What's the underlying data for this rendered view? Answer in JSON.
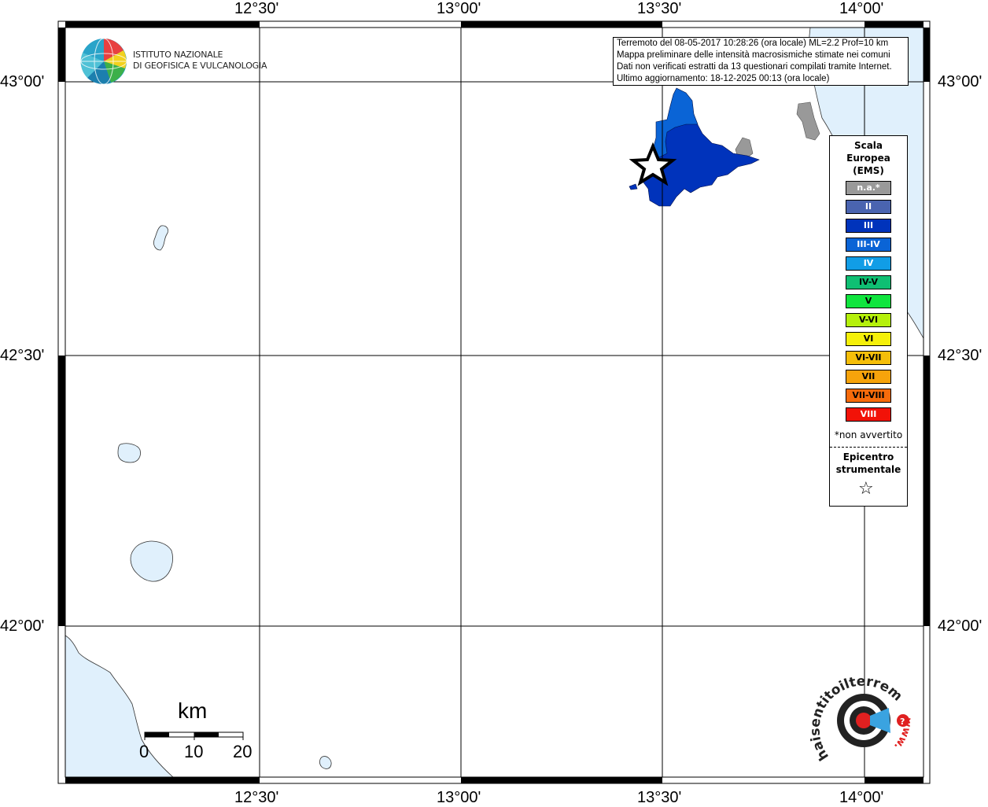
{
  "map": {
    "lon_labels": [
      "12°30'",
      "13°00'",
      "13°30'",
      "14°00'"
    ],
    "lat_labels": [
      "43°00'",
      "42°30'",
      "42°00'"
    ],
    "colors": {
      "sea": "#e0f0fc",
      "coast_stroke": "#333333",
      "grid": "#000000",
      "intensity_III": "#0033bb",
      "intensity_III_IV": "#0a64d6",
      "na_gray": "#999999"
    }
  },
  "logo": {
    "line1": "ISTITUTO NAZIONALE",
    "line2": "DI GEOFISICA E VULCANOLOGIA"
  },
  "info": {
    "line1": "Terremoto del 08-05-2017 10:28:26 (ora locale) ML=2.2 Prof=10 km",
    "line2": "Mappa preliminare delle intensità macrosismiche stimate nei comuni",
    "line3": "Dati non verificati estratti da 13 questionari compilati tramite Internet.",
    "line4": "Ultimo aggiornamento: 18-12-2025 00:13 (ora locale)"
  },
  "legend": {
    "title1": "Scala",
    "title2": "Europea",
    "title3": "(EMS)",
    "items": [
      {
        "label": "n.a.*",
        "color": "#999999",
        "text_color": "#ffffff"
      },
      {
        "label": "II",
        "color": "#4a64b0",
        "text_color": "#ffffff"
      },
      {
        "label": "III",
        "color": "#0033bb",
        "text_color": "#ffffff"
      },
      {
        "label": "III-IV",
        "color": "#0a64d6",
        "text_color": "#ffffff"
      },
      {
        "label": "IV",
        "color": "#119de6",
        "text_color": "#ffffff"
      },
      {
        "label": "IV-V",
        "color": "#0fbf73",
        "text_color": "#000000"
      },
      {
        "label": "V",
        "color": "#10e53e",
        "text_color": "#000000"
      },
      {
        "label": "V-VI",
        "color": "#b5f00b",
        "text_color": "#000000"
      },
      {
        "label": "VI",
        "color": "#f5f00a",
        "text_color": "#000000"
      },
      {
        "label": "VI-VII",
        "color": "#f5be0a",
        "text_color": "#000000"
      },
      {
        "label": "VII",
        "color": "#f7a30b",
        "text_color": "#000000"
      },
      {
        "label": "VII-VIII",
        "color": "#f66b0b",
        "text_color": "#000000"
      },
      {
        "label": "VIII",
        "color": "#f21208",
        "text_color": "#ffffff"
      }
    ],
    "na_note": "*non avvertito",
    "epi1": "Epicentro",
    "epi2": "strumentale",
    "epi_symbol": "☆"
  },
  "scalebar": {
    "unit": "km",
    "ticks": [
      "0",
      "10",
      "20"
    ]
  },
  "hsit_logo": {
    "ring_text": "haisentitoilterremoto.it",
    "www": "www.",
    "icon": "speaker-icon"
  }
}
